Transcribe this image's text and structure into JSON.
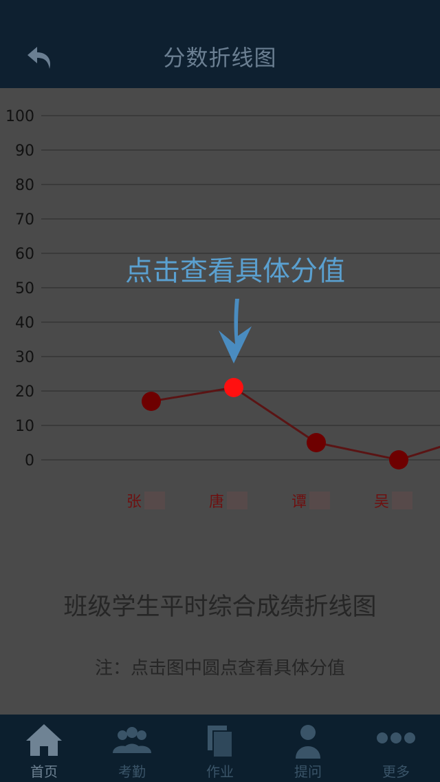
{
  "header": {
    "title": "分数折线图"
  },
  "chart_data": {
    "type": "line",
    "title": "班级学生平时综合成绩折线图",
    "note": "注：点击图中圆点查看具体分值",
    "yticks": [
      "100",
      "90",
      "80",
      "70",
      "60",
      "50",
      "40",
      "30",
      "20",
      "10",
      "0"
    ],
    "ylim": [
      0,
      100
    ],
    "categories": [
      "张",
      "唐",
      "谭",
      "吴"
    ],
    "values": [
      17,
      21,
      5,
      0
    ],
    "highlight_index": 1,
    "colors": {
      "line": "#5a1414",
      "point": "#6e0000",
      "highlight": "#ff1010",
      "label": "#6e1010",
      "grid": "#3a3a3a"
    }
  },
  "overlay": {
    "hint": "点击查看具体分值"
  },
  "tabbar": {
    "tabs": [
      {
        "label": "首页",
        "icon": "home-icon"
      },
      {
        "label": "考勤",
        "icon": "people-icon"
      },
      {
        "label": "作业",
        "icon": "documents-icon"
      },
      {
        "label": "提问",
        "icon": "person-icon"
      },
      {
        "label": "更多",
        "icon": "more-icon"
      }
    ]
  }
}
